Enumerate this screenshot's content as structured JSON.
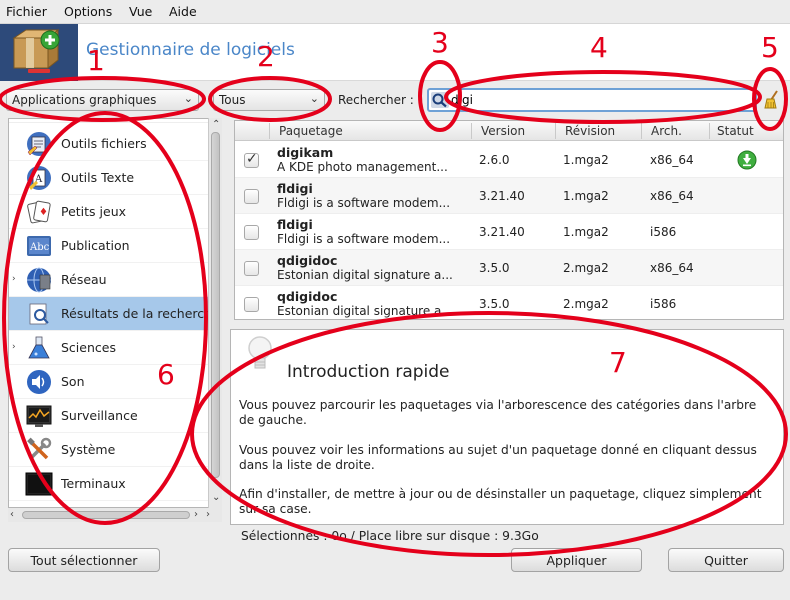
{
  "menubar": {
    "items": [
      {
        "label": "Fichier"
      },
      {
        "label": "Options"
      },
      {
        "label": "Vue"
      },
      {
        "label": "Aide"
      }
    ]
  },
  "header": {
    "title": "Gestionnaire de logiciels",
    "logo_icon": "package-box-icon"
  },
  "toolbar": {
    "category_filter": "Applications graphiques",
    "type_filter": "Tous",
    "search_label": "Rechercher :",
    "search_value": "digi",
    "search_icon": "magnifier-icon",
    "clear_icon": "broom-clear-icon"
  },
  "sidebar": {
    "items": [
      {
        "label": "Outils fichiers",
        "icon": "file-tools-icon",
        "expandable": false
      },
      {
        "label": "Outils Texte",
        "icon": "text-tools-icon",
        "expandable": false
      },
      {
        "label": "Petits jeux",
        "icon": "cards-icon",
        "expandable": false
      },
      {
        "label": "Publication",
        "icon": "publishing-icon",
        "expandable": false
      },
      {
        "label": "Réseau",
        "icon": "network-globe-icon",
        "expandable": true
      },
      {
        "label": "Résultats de la recherche",
        "icon": "search-results-icon",
        "expandable": false,
        "selected": true
      },
      {
        "label": "Sciences",
        "icon": "flask-icon",
        "expandable": true
      },
      {
        "label": "Son",
        "icon": "speaker-icon",
        "expandable": false
      },
      {
        "label": "Surveillance",
        "icon": "monitor-graph-icon",
        "expandable": false
      },
      {
        "label": "Système",
        "icon": "tools-icon",
        "expandable": false
      },
      {
        "label": "Terminaux",
        "icon": "terminal-icon",
        "expandable": false
      }
    ]
  },
  "table": {
    "columns": [
      "Paquetage",
      "Version",
      "Révision",
      "Arch.",
      "Statut"
    ],
    "rows": [
      {
        "name": "digikam",
        "desc": "A KDE photo management...",
        "version": "2.6.0",
        "revision": "1.mga2",
        "arch": "x86_64",
        "checked": true,
        "status_icon": "install-arrow-icon"
      },
      {
        "name": "fldigi",
        "desc": "Fldigi is a software modem...",
        "version": "3.21.40",
        "revision": "1.mga2",
        "arch": "x86_64",
        "checked": false
      },
      {
        "name": "fldigi",
        "desc": "Fldigi is a software modem...",
        "version": "3.21.40",
        "revision": "1.mga2",
        "arch": "i586",
        "checked": false
      },
      {
        "name": "qdigidoc",
        "desc": "Estonian digital signature a...",
        "version": "3.5.0",
        "revision": "2.mga2",
        "arch": "x86_64",
        "checked": false
      },
      {
        "name": "qdigidoc",
        "desc": "Estonian digital signature a...",
        "version": "3.5.0",
        "revision": "2.mga2",
        "arch": "i586",
        "checked": false
      }
    ]
  },
  "info": {
    "bulb_icon": "lightbulb-icon",
    "title": "Introduction rapide",
    "p1": "Vous pouvez parcourir les paquetages via l'arborescence des catégories dans l'arbre de gauche.",
    "p2": "Vous pouvez voir les informations au sujet d'un paquetage donné en cliquant dessus dans la liste de droite.",
    "p3": "Afin d'installer, de mettre à jour ou de désinstaller un paquetage, cliquez simplement sur sa case."
  },
  "footer": {
    "status": "Sélectionnés : 0o / Place libre sur disque : 9.3Go",
    "select_all": "Tout sélectionner",
    "apply": "Appliquer",
    "quit": "Quitter"
  },
  "annotations": {
    "color": "#e4001b",
    "labels": [
      "1",
      "2",
      "3",
      "4",
      "5",
      "6",
      "7"
    ]
  }
}
